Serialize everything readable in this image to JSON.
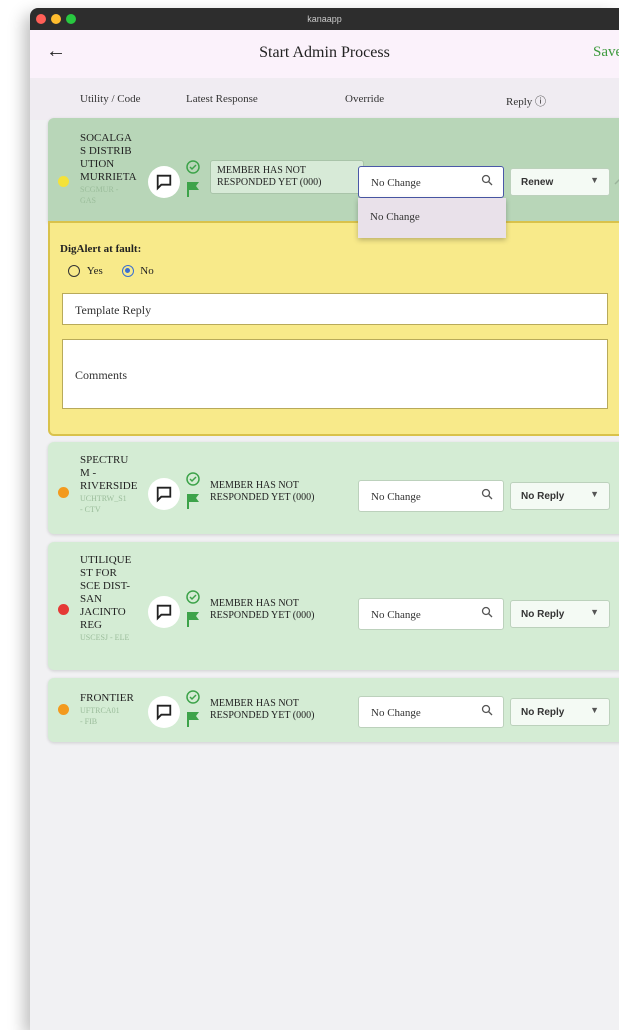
{
  "window": {
    "title": "kanaapp"
  },
  "appbar": {
    "back_icon": "←",
    "title": "Start Admin Process",
    "save_label": "Save"
  },
  "columns": {
    "utility": "Utility / Code",
    "latest": "Latest Response",
    "override": "Override",
    "reply": "Reply ⓘ"
  },
  "rows": [
    {
      "name": "SOCALGAS DISTRIBUTION MURRIETA",
      "name_lines": [
        "SOCALGA",
        "S DISTRIB",
        "UTION",
        "MURRIETA"
      ],
      "code_lines": [
        "SCGMUR -",
        "GAS"
      ],
      "status_color": "#f4e23a",
      "latest_lines": [
        "MEMBER HAS NOT",
        "RESPONDED YET (000)"
      ],
      "override_value": "No Change",
      "reply_value": "Renew"
    },
    {
      "name": "SPECTRUM - RIVERSIDE",
      "name_lines": [
        "SPECTRU",
        "M -",
        "RIVERSIDE"
      ],
      "code_lines": [
        "UCHTRW_S1",
        "- CTV"
      ],
      "status_color": "#f39a1e",
      "latest_lines": [
        "MEMBER HAS NOT",
        "RESPONDED YET (000)"
      ],
      "override_value": "No Change",
      "reply_value": "No Reply"
    },
    {
      "name": "UTILIQUEST FOR SCE DIST-SAN JACINTO REG",
      "name_lines": [
        "UTILIQUE",
        "ST FOR",
        "SCE DIST-",
        "SAN",
        "JACINTO",
        "REG"
      ],
      "code_lines": [
        "USCESJ - ELE"
      ],
      "status_color": "#e53935",
      "latest_lines": [
        "MEMBER HAS NOT",
        "RESPONDED YET (000)"
      ],
      "override_value": "No Change",
      "reply_value": "No Reply"
    },
    {
      "name": "FRONTIER",
      "name_lines": [
        "FRONTIER"
      ],
      "code_lines": [
        "UFTRCA01",
        "- FIB"
      ],
      "status_color": "#f39a1e",
      "latest_lines": [
        "MEMBER HAS NOT",
        "RESPONDED YET (000)"
      ],
      "override_value": "No Change",
      "reply_value": "No Reply"
    }
  ],
  "dropdown": {
    "options": [
      "No Change"
    ]
  },
  "digalert": {
    "label": "DigAlert at fault:",
    "yes_label": "Yes",
    "no_label": "No",
    "selected": "No",
    "template_placeholder": "Template Reply",
    "comments_placeholder": "Comments"
  },
  "colors": {
    "accent_green": "#3d9a3d",
    "row_bg": "#d4ecd4",
    "active_row_bg": "#b8d6b8",
    "panel_yellow": "#f8ea8a"
  },
  "icons": [
    "back-arrow-icon",
    "chat-bubble-icon",
    "clock-check-icon",
    "flag-icon",
    "search-icon",
    "chevron-down-icon",
    "chevron-up-icon",
    "info-icon"
  ]
}
